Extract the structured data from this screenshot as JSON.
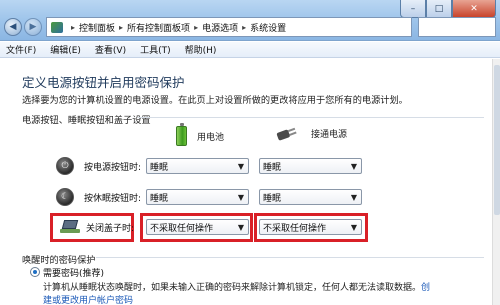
{
  "window": {
    "minimize": "–",
    "maximize": "□",
    "close": "✕"
  },
  "nav": {
    "back": "◀",
    "forward": "▶"
  },
  "breadcrumb": {
    "items": [
      "控制面板",
      "所有控制面板项",
      "电源选项",
      "系统设置"
    ]
  },
  "menu": {
    "items": [
      "文件(F)",
      "编辑(E)",
      "查看(V)",
      "工具(T)",
      "帮助(H)"
    ]
  },
  "page": {
    "title": "定义电源按钮并启用密码保护",
    "description": "选择要为您的计算机设置的电源设置。在此页上对设置所做的更改将应用于您所有的电源计划。"
  },
  "power_section": {
    "label": "电源按钮、睡眠按钮和盖子设置",
    "col_battery": "用电池",
    "col_ac": "接通电源",
    "rows": [
      {
        "label": "按电源按钮时:",
        "battery": "睡眠",
        "ac": "睡眠",
        "icon": "power-button-icon"
      },
      {
        "label": "按休眠按钮时:",
        "battery": "睡眠",
        "ac": "睡眠",
        "icon": "sleep-button-icon"
      },
      {
        "label": "关闭盖子时:",
        "battery": "不采取任何操作",
        "ac": "不采取任何操作",
        "icon": "laptop-lid-icon"
      }
    ]
  },
  "wake_section": {
    "label": "唤醒时的密码保护",
    "option_label": "需要密码(推荐)",
    "desc_text": "计算机从睡眠状态唤醒时，如果未输入正确的密码来解除计算机锁定，任何人都无法读取数据。",
    "desc_link": "创",
    "link_line": "建或更改用户帐户密码"
  },
  "colors": {
    "highlight": "#d92027",
    "title": "#1e395b",
    "link": "#1a58b7"
  }
}
